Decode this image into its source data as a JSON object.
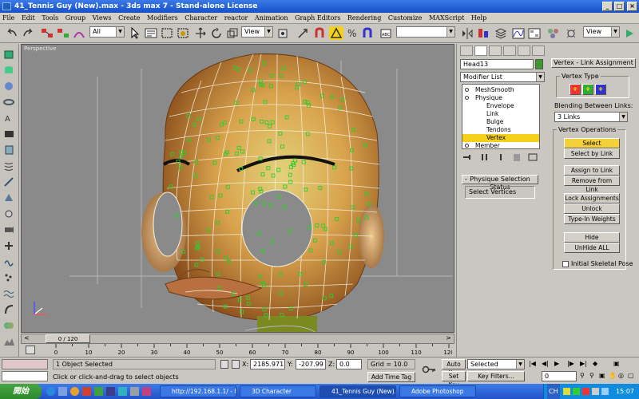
{
  "window": {
    "title": "41_Tennis Guy (New).max - 3ds max 7 - Stand-alone License"
  },
  "menu": [
    "File",
    "Edit",
    "Tools",
    "Group",
    "Views",
    "Create",
    "Modifiers",
    "Character",
    "reactor",
    "Animation",
    "Graph Editors",
    "Rendering",
    "Customize",
    "MAXScript",
    "Help"
  ],
  "toolbar": {
    "selection_filter": "All",
    "ref_coord": "View",
    "ref_coord_right": "View"
  },
  "viewport": {
    "label": "Perspective"
  },
  "timeline": {
    "frame_display": "0 / 120",
    "ticks": [
      "0",
      "10",
      "20",
      "30",
      "40",
      "50",
      "60",
      "70",
      "80",
      "90",
      "100",
      "110",
      "120"
    ]
  },
  "panel": {
    "object_name": "Head13",
    "modifier_list": "Modifier List",
    "stack": [
      "MeshSmooth",
      "Physique",
      "Envelope",
      "Link",
      "Bulge",
      "Tendons",
      "Vertex",
      "Member"
    ],
    "physique_status": {
      "header": "Physique Selection Status",
      "value": "Select Vertices"
    },
    "vla": {
      "header": "Vertex - Link Assignment",
      "vertex_type": "Vertex Type",
      "blending_label": "Blending Between Links:",
      "blending_value": "3 Links",
      "ops_label": "Vertex Operations",
      "buttons": [
        "Select",
        "Select by Link",
        "Assign to Link",
        "Remove from Link",
        "Lock Assignments",
        "Unlock Assignments",
        "Type-In Weights",
        "Hide",
        "UnHide ALL"
      ],
      "initial_pose": "Initial Skeletal Pose"
    }
  },
  "status": {
    "selection": "1 Object Selected",
    "prompt": "Click or click-and-drag to select objects",
    "x_label": "X:",
    "x_value": "2185.971",
    "y_label": "Y:",
    "y_value": "-207.99",
    "z_label": "Z:",
    "z_value": "0.0",
    "grid": "Grid = 10.0",
    "add_time_tag": "Add Time Tag",
    "auto_key": "Auto Key",
    "set_key": "Set Key",
    "key_mode": "Selected",
    "key_filters": "Key Filters...",
    "frame": "0"
  },
  "taskbar": {
    "start": "開始",
    "tasks": [
      "http://192.168.1.1/ - M...",
      "3D Character",
      "41_Tennis Guy (New)....",
      "Adobe Photoshop"
    ],
    "lang": "CH",
    "time": "15:07"
  },
  "colors": {
    "titlebar": "#1650c8",
    "viewport_bg": "#8a8a8a",
    "selected_yellow": "#f3d11b",
    "wire_green": "#2ecc2e",
    "skin": "#d9a24c"
  }
}
